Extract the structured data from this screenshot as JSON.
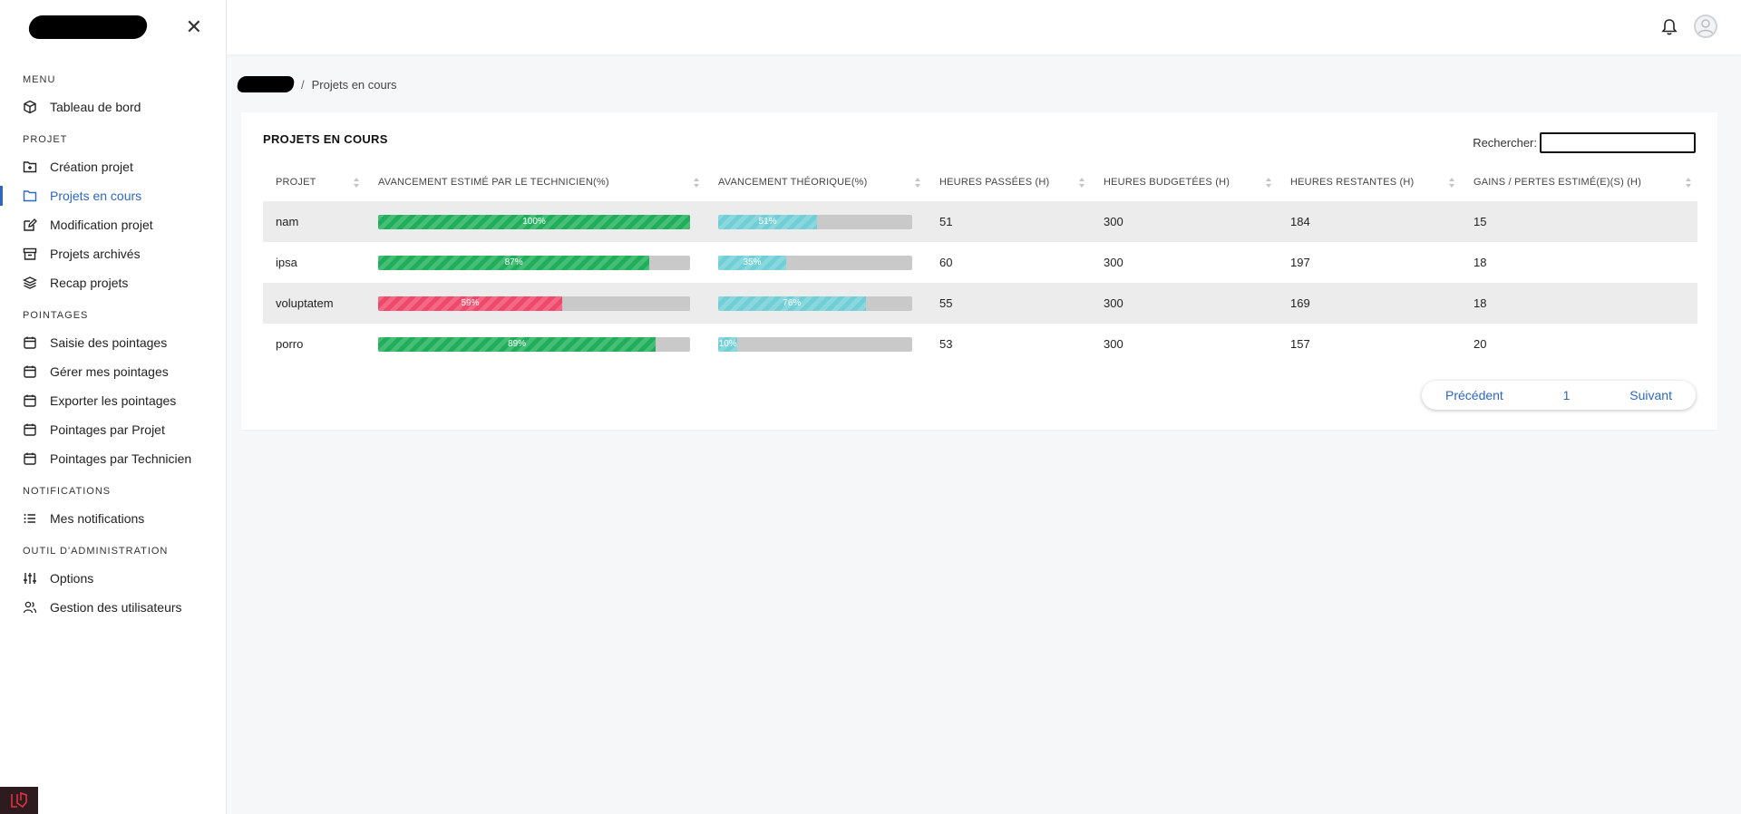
{
  "menu": {
    "sections": [
      {
        "title": "MENU",
        "items": [
          {
            "label": "Tableau de bord",
            "icon": "cube-icon"
          }
        ]
      },
      {
        "title": "PROJET",
        "items": [
          {
            "label": "Création projet",
            "icon": "folder-plus-icon"
          },
          {
            "label": "Projets en cours",
            "icon": "folder-icon",
            "active": true
          },
          {
            "label": "Modification projet",
            "icon": "edit-icon"
          },
          {
            "label": "Projets archivés",
            "icon": "archive-icon"
          },
          {
            "label": "Recap projets",
            "icon": "layers-icon"
          }
        ]
      },
      {
        "title": "POINTAGES",
        "items": [
          {
            "label": "Saisie des pointages",
            "icon": "calendar-icon"
          },
          {
            "label": "Gérer mes pointages",
            "icon": "calendar-icon"
          },
          {
            "label": "Exporter les pointages",
            "icon": "calendar-icon"
          },
          {
            "label": "Pointages par Projet",
            "icon": "calendar-icon"
          },
          {
            "label": "Pointages par Technicien",
            "icon": "calendar-icon"
          }
        ]
      },
      {
        "title": "NOTIFICATIONS",
        "items": [
          {
            "label": "Mes notifications",
            "icon": "list-icon"
          }
        ]
      },
      {
        "title": "OUTIL D'ADMINISTRATION",
        "items": [
          {
            "label": "Options",
            "icon": "sliders-icon"
          },
          {
            "label": "Gestion des utilisateurs",
            "icon": "users-icon"
          }
        ]
      }
    ]
  },
  "breadcrumb": {
    "separator": "/",
    "current": "Projets en cours"
  },
  "card": {
    "title": "PROJETS EN COURS",
    "search_label": "Rechercher:",
    "search_value": ""
  },
  "table": {
    "headers": [
      "PROJET",
      "AVANCEMENT ESTIMÉ PAR LE TECHNICIEN(%)",
      "AVANCEMENT THÉORIQUE(%)",
      "HEURES PASSÉES (H)",
      "HEURES BUDGETÉES (H)",
      "HEURES RESTANTES (H)",
      "GAINS / PERTES ESTIMÉ(E)(S) (H)"
    ],
    "rows": [
      {
        "projet": "nam",
        "tech_pct": 100,
        "tech_label": "100%",
        "tech_color": "green",
        "theo_pct": 51,
        "theo_label": "51%",
        "passees": "51",
        "budgetees": "300",
        "restantes": "184",
        "gains": "15"
      },
      {
        "projet": "ipsa",
        "tech_pct": 87,
        "tech_label": "87%",
        "tech_color": "green",
        "theo_pct": 35,
        "theo_label": "35%",
        "passees": "60",
        "budgetees": "300",
        "restantes": "197",
        "gains": "18"
      },
      {
        "projet": "voluptatem",
        "tech_pct": 59,
        "tech_label": "59%",
        "tech_color": "red",
        "theo_pct": 76,
        "theo_label": "76%",
        "passees": "55",
        "budgetees": "300",
        "restantes": "169",
        "gains": "18"
      },
      {
        "projet": "porro",
        "tech_pct": 89,
        "tech_label": "89%",
        "tech_color": "green",
        "theo_pct": 10,
        "theo_label": "10%",
        "passees": "53",
        "budgetees": "300",
        "restantes": "157",
        "gains": "20"
      }
    ]
  },
  "pagination": {
    "prev": "Précédent",
    "page": "1",
    "next": "Suivant"
  },
  "colors": {
    "accent": "#2c67c4",
    "green": "#1fae5a",
    "red": "#f0486a",
    "cyan": "#70cfd6",
    "track": "#c9c9c9"
  }
}
